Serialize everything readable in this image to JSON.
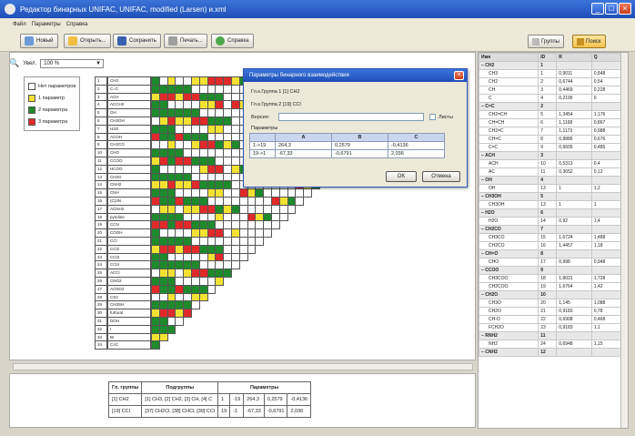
{
  "window": {
    "title": "Редактор бинарных UNIFAC, UNIFAC, modified (Larsen) и.xml",
    "min": "_",
    "max": "□",
    "close": "×"
  },
  "menu": [
    "Файл",
    "Параметры",
    "Справка"
  ],
  "toolbar": {
    "new": "Новый",
    "open": "Открыть...",
    "save": "Сохранить",
    "print": "Печать...",
    "help": "Справка"
  },
  "right_toolbar": {
    "groups": "Группы",
    "search": "Поиск"
  },
  "zoom": {
    "label": "Увел.",
    "value": "100 %"
  },
  "legend": [
    {
      "label": "Нет параметров",
      "color": "#ffffff"
    },
    {
      "label": "1 параметр",
      "color": "#f2e233"
    },
    {
      "label": "2 параметра",
      "color": "#1f8a2c"
    },
    {
      "label": "3 параметра",
      "color": "#e02a2a"
    }
  ],
  "matrix_rows": [
    "CH2",
    "C=C",
    "ACH",
    "ACCH2",
    "OH",
    "CH3OH",
    "H2O",
    "ACOH",
    "CH2CO",
    "CHO",
    "CCOO",
    "HCOO",
    "CH2O",
    "CNH2",
    "CNH",
    "(C)3N",
    "ACNH2",
    "pyridine",
    "CCN",
    "COOH",
    "CCl",
    "CCl2",
    "CCl3",
    "CCl4",
    "ACCl",
    "CNO2",
    "ACNO2",
    "CS2",
    "CH3SH",
    "furfural",
    "DOH",
    "I",
    "Br",
    "C≡C"
  ],
  "colors": {
    "white": "#ffffff",
    "yellow": "#f2e233",
    "green": "#1f8a2c",
    "red": "#e02a2a"
  },
  "dialog": {
    "title": "Параметры бинарного взаимодействия",
    "group1": "Гл.к.Группа 1 [1] CH2",
    "group2": "Гл.к.Группа 2 [19] CCl",
    "version_label": "Версия:",
    "checkbox_label": "Листы",
    "params_label": "Параметры",
    "headers": [
      "",
      "A",
      "B",
      "C"
    ],
    "rows": [
      [
        "1->19",
        "264,3",
        "0,2579",
        "-0,4136"
      ],
      [
        "19->1",
        "-67,33",
        "-0,6791",
        "2,036"
      ]
    ],
    "ok": "OK",
    "cancel": "Отмена"
  },
  "bottom_table": {
    "headers": [
      "Гл. группы",
      "Подгруппы",
      "Параметры"
    ],
    "rows": [
      [
        "[1] CH2",
        "[1] CH3, [2] CH2, [3] CH, [4] C",
        "1",
        "-19",
        "264,3",
        "0,2579",
        "-0,4136"
      ],
      [
        "[19] CCl",
        "[37] CH2Cl, [38] CHCl, [39] CCl",
        "19",
        "-1",
        "-67,33",
        "-0,6791",
        "2,036"
      ]
    ]
  },
  "right_table": {
    "headers": [
      "Имя",
      "ID",
      "R",
      "Q"
    ],
    "rows": [
      {
        "grp": true,
        "c": [
          "CH2",
          "1",
          "",
          ""
        ]
      },
      {
        "grp": false,
        "c": [
          "CH3",
          "1",
          "0,9011",
          "0,848"
        ]
      },
      {
        "grp": false,
        "c": [
          "CH2",
          "2",
          "0,6744",
          "0,54"
        ]
      },
      {
        "grp": false,
        "c": [
          "CH",
          "3",
          "0,4469",
          "0,228"
        ]
      },
      {
        "grp": false,
        "c": [
          "C",
          "4",
          "0,2195",
          "0"
        ]
      },
      {
        "grp": true,
        "c": [
          "C=C",
          "2",
          "",
          ""
        ]
      },
      {
        "grp": false,
        "c": [
          "CH2=CH",
          "5",
          "1,3454",
          "1,176"
        ]
      },
      {
        "grp": false,
        "c": [
          "CH=CH",
          "6",
          "1,1168",
          "0,867"
        ]
      },
      {
        "grp": false,
        "c": [
          "CH2=C",
          "7",
          "1,1173",
          "0,988"
        ]
      },
      {
        "grp": false,
        "c": [
          "CH=C",
          "8",
          "0,8886",
          "0,676"
        ]
      },
      {
        "grp": false,
        "c": [
          "C=C",
          "9",
          "0,6605",
          "0,485"
        ]
      },
      {
        "grp": true,
        "c": [
          "ACH",
          "3",
          "",
          ""
        ]
      },
      {
        "grp": false,
        "c": [
          "ACH",
          "10",
          "0,5313",
          "0,4"
        ]
      },
      {
        "grp": false,
        "c": [
          "AC",
          "11",
          "0,3652",
          "0,12"
        ]
      },
      {
        "grp": true,
        "c": [
          "OH",
          "4",
          "",
          ""
        ]
      },
      {
        "grp": false,
        "c": [
          "OH",
          "13",
          "1",
          "1,2"
        ]
      },
      {
        "grp": true,
        "c": [
          "CH3OH",
          "5",
          "",
          ""
        ]
      },
      {
        "grp": false,
        "c": [
          "CH3OH",
          "13",
          "1",
          "1"
        ]
      },
      {
        "grp": true,
        "c": [
          "H2O",
          "6",
          "",
          ""
        ]
      },
      {
        "grp": false,
        "c": [
          "H2O",
          "14",
          "0,92",
          "1,4"
        ]
      },
      {
        "grp": true,
        "c": [
          "CH2CO",
          "7",
          "",
          ""
        ]
      },
      {
        "grp": false,
        "c": [
          "CH3CO",
          "15",
          "1,6724",
          "1,488"
        ]
      },
      {
        "grp": false,
        "c": [
          "CH2CO",
          "16",
          "1,4457",
          "1,18"
        ]
      },
      {
        "grp": true,
        "c": [
          "CH=O",
          "8",
          "",
          ""
        ]
      },
      {
        "grp": false,
        "c": [
          "CHO",
          "17",
          "0,998",
          "0,948"
        ]
      },
      {
        "grp": true,
        "c": [
          "CCOO",
          "9",
          "",
          ""
        ]
      },
      {
        "grp": false,
        "c": [
          "CH3COO",
          "18",
          "1,9031",
          "1,728"
        ]
      },
      {
        "grp": false,
        "c": [
          "CH2COO",
          "19",
          "1,6764",
          "1,42"
        ]
      },
      {
        "grp": true,
        "c": [
          "CH2O",
          "10",
          "",
          ""
        ]
      },
      {
        "grp": false,
        "c": [
          "CH3O",
          "20",
          "1,145",
          "1,088"
        ]
      },
      {
        "grp": false,
        "c": [
          "CH2O",
          "21",
          "0,9183",
          "0,78"
        ]
      },
      {
        "grp": false,
        "c": [
          "CH-O",
          "22",
          "0,6908",
          "0,468"
        ]
      },
      {
        "grp": false,
        "c": [
          "FCH2O",
          "23",
          "0,9183",
          "1,1"
        ]
      },
      {
        "grp": true,
        "c": [
          "RNH2",
          "11",
          "",
          ""
        ]
      },
      {
        "grp": false,
        "c": [
          "NH2",
          "24",
          "0,6948",
          "1,15"
        ]
      },
      {
        "grp": true,
        "c": [
          "CNH2",
          "12",
          "",
          ""
        ]
      }
    ]
  }
}
